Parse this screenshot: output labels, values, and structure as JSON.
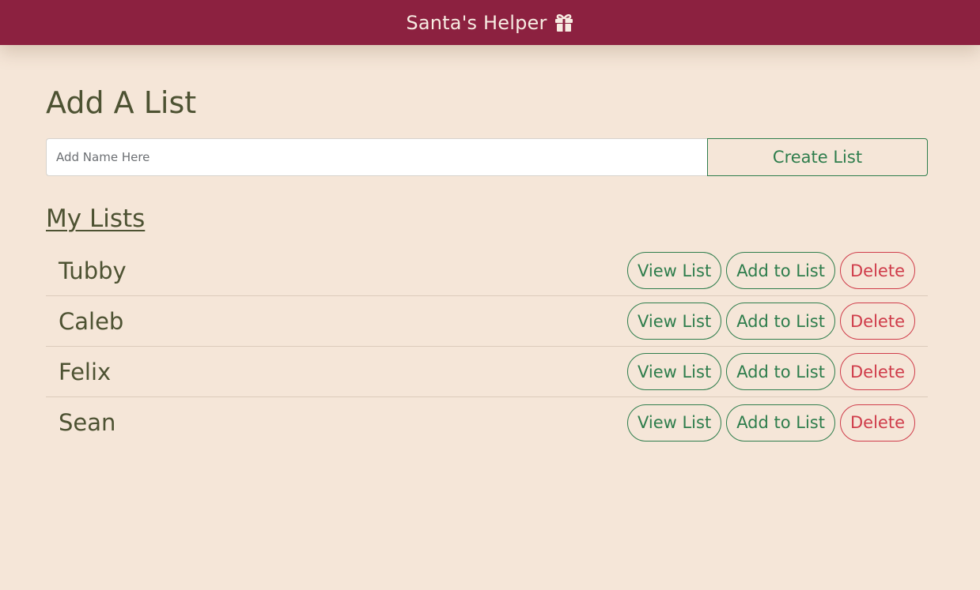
{
  "header": {
    "title": "Santa's Helper",
    "icon": "gift-icon"
  },
  "colors": {
    "header_bg": "#8c2140",
    "page_bg": "#f5e6d8",
    "text": "#4d5232",
    "green": "#2e7d4c",
    "red": "#cf3c4a"
  },
  "add_list": {
    "title": "Add A List",
    "input_value": "",
    "input_placeholder": "Add Name Here",
    "create_button_label": "Create List"
  },
  "my_lists": {
    "heading": "My Lists",
    "view_label": "View List",
    "add_label": "Add to List",
    "delete_label": "Delete",
    "items": [
      {
        "name": "Tubby"
      },
      {
        "name": "Caleb"
      },
      {
        "name": "Felix"
      },
      {
        "name": "Sean"
      }
    ]
  }
}
